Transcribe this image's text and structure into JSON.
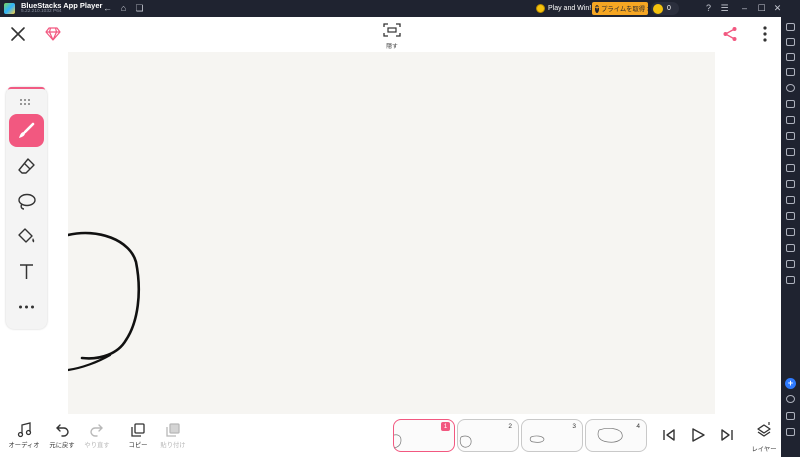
{
  "window": {
    "title": "BlueStacks App Player",
    "version": "5.22.210.1032  P64",
    "play_and_win": "Play and Win!",
    "premium_button": "プライムを取得 >",
    "coin_count": "0"
  },
  "toolbar": {
    "hide_label": "隠す"
  },
  "tools": [
    {
      "name": "brush",
      "active": true
    },
    {
      "name": "eraser",
      "active": false
    },
    {
      "name": "lasso",
      "active": false
    },
    {
      "name": "fill",
      "active": false
    },
    {
      "name": "text",
      "active": false
    },
    {
      "name": "more",
      "active": false
    }
  ],
  "bottom": {
    "audio_label": "オーディオ",
    "undo_label": "元に戻す",
    "redo_label": "やり直す",
    "copy_label": "コピー",
    "paste_label": "貼り付け",
    "layer_label": "レイヤー",
    "frames": [
      {
        "number": "1",
        "active": true
      },
      {
        "number": "2",
        "active": false
      },
      {
        "number": "3",
        "active": false
      },
      {
        "number": "4",
        "active": false
      }
    ]
  },
  "colors": {
    "accent": "#f25880",
    "paper": "#f6f5f2",
    "bluestacks_bar": "#1f2330"
  }
}
